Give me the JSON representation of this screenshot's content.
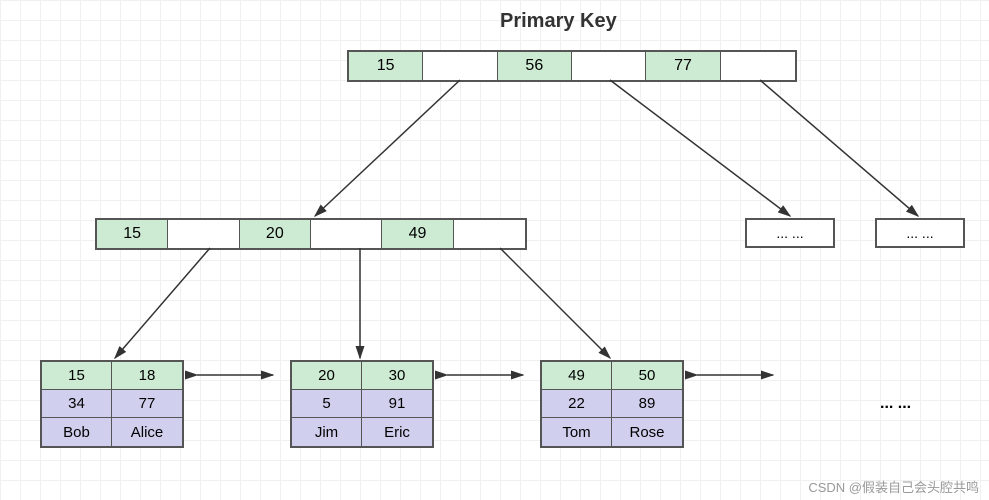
{
  "title": "Primary Key",
  "root": {
    "cells": [
      "15",
      "",
      "56",
      "",
      "77",
      ""
    ]
  },
  "mid_left": {
    "cells": [
      "15",
      "",
      "20",
      "",
      "49",
      ""
    ]
  },
  "mid_ellipsis_1": "... ...",
  "mid_ellipsis_2": "... ...",
  "leaves": [
    {
      "keys": [
        "15",
        "18"
      ],
      "vals1": [
        "34",
        "77"
      ],
      "vals2": [
        "Bob",
        "Alice"
      ]
    },
    {
      "keys": [
        "20",
        "30"
      ],
      "vals1": [
        "5",
        "91"
      ],
      "vals2": [
        "Jim",
        "Eric"
      ]
    },
    {
      "keys": [
        "49",
        "50"
      ],
      "vals1": [
        "22",
        "89"
      ],
      "vals2": [
        "Tom",
        "Rose"
      ]
    }
  ],
  "trailing_dots": "... ...",
  "watermark": "CSDN @假装自己会头腔共鸣"
}
